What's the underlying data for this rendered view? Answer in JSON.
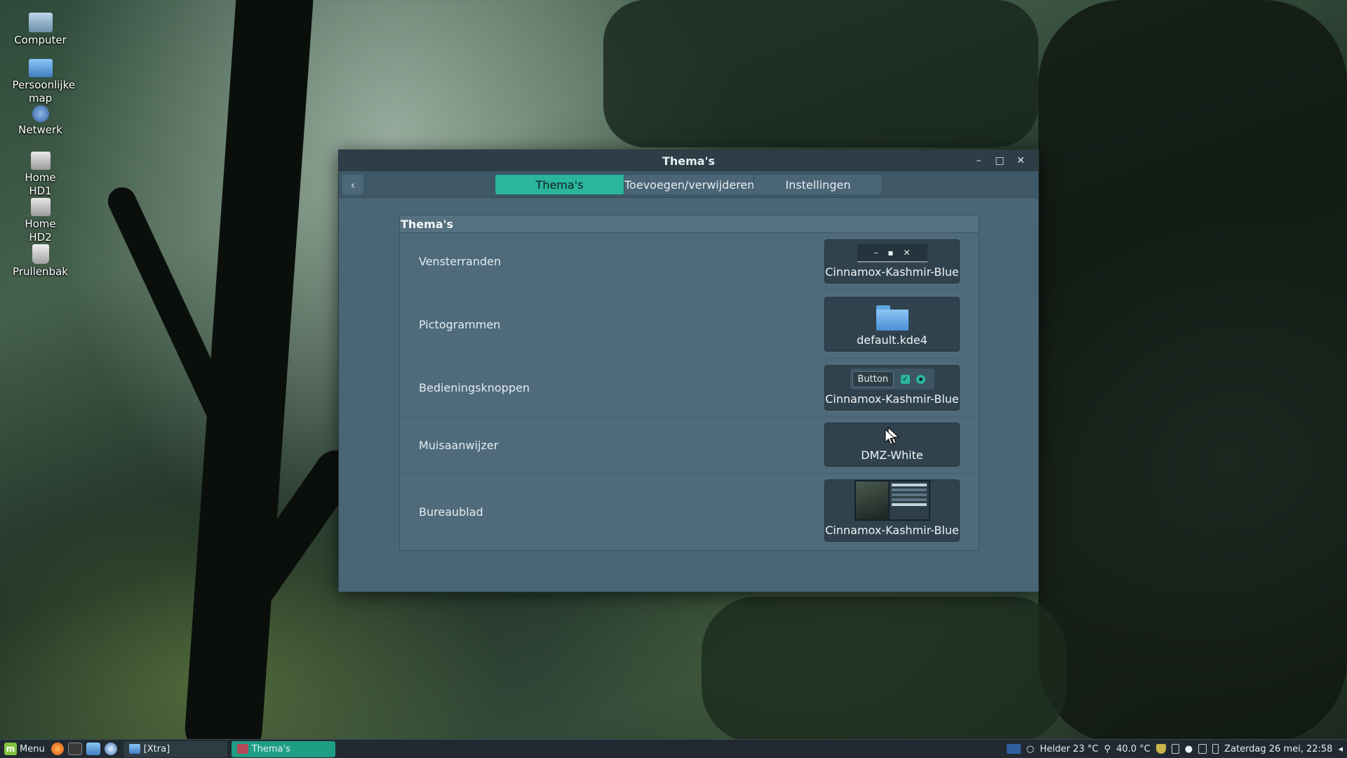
{
  "desktop": {
    "icons": [
      {
        "label": "Computer",
        "icon": "computer-icon"
      },
      {
        "label": "Persoonlijke map",
        "icon": "home-folder-icon"
      },
      {
        "label": "Netwerk",
        "icon": "network-icon"
      },
      {
        "label": "Home HD1",
        "icon": "drive-icon"
      },
      {
        "label": "Home HD2",
        "icon": "drive-icon"
      },
      {
        "label": "Prullenbak",
        "icon": "trash-icon"
      }
    ]
  },
  "window": {
    "title": "Thema's",
    "controls": {
      "minimize": "–",
      "maximize": "□",
      "close": "✕"
    },
    "back_icon": "‹",
    "tabs": [
      {
        "label": "Thema's",
        "active": true
      },
      {
        "label": "Toevoegen/verwijderen",
        "active": false
      },
      {
        "label": "Instellingen",
        "active": false
      }
    ],
    "section_title": "Thema's",
    "rows": [
      {
        "label": "Vensterranden",
        "value": "Cinnamox-Kashmir-Blue",
        "preview": "window-borders"
      },
      {
        "label": "Pictogrammen",
        "value": "default.kde4",
        "preview": "folder-icon"
      },
      {
        "label": "Bedieningsknoppen",
        "value": "Cinnamox-Kashmir-Blue",
        "preview": "controls"
      },
      {
        "label": "Muisaanwijzer",
        "value": "DMZ-White",
        "preview": "cursor"
      },
      {
        "label": "Bureaublad",
        "value": "Cinnamox-Kashmir-Blue",
        "preview": "desktop"
      }
    ],
    "preview_button_label": "Button",
    "preview_wm_buttons": {
      "minimize": "–",
      "maximize": "▪",
      "close": "✕"
    }
  },
  "taskbar": {
    "menu_label": "Menu",
    "tasks": [
      {
        "label": "[Xtra]"
      },
      {
        "label": "Thema's"
      }
    ],
    "weather": "Helder 23 °C",
    "temperature": "40.0 °C",
    "datetime": "Zaterdag 26 mei, 22:58"
  },
  "colors": {
    "accent": "#2ab59c",
    "window_bg": "#4a6575",
    "titlebar": "#2d3e47"
  }
}
